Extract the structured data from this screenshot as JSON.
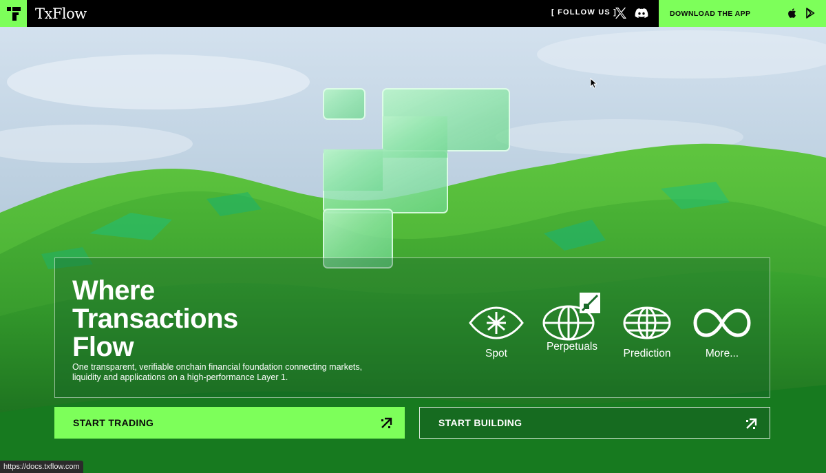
{
  "header": {
    "brand": "TxFlow",
    "follow_label": "[ FOLLOW US ]",
    "social": [
      "x-icon",
      "discord-icon"
    ],
    "download_label": "DOWNLOAD THE APP",
    "stores": [
      "apple-icon",
      "google-play-icon"
    ]
  },
  "hero": {
    "headline": [
      "Where",
      "Transactions",
      "Flow"
    ],
    "subtext": "One transparent, verifiable onchain financial foundation connecting markets, liquidity and applications on a high-performance Layer 1.",
    "features": [
      {
        "label": "Spot",
        "icon": "spot-eye-icon"
      },
      {
        "label": "Perpetuals",
        "icon": "perpetuals-globe-icon"
      },
      {
        "label": "Prediction",
        "icon": "prediction-globe-icon"
      },
      {
        "label": "More...",
        "icon": "infinity-icon"
      }
    ]
  },
  "actions": {
    "start_trading": "START TRADING",
    "start_building": "START BUILDING"
  },
  "status_bar": {
    "url": "https://docs.txflow.com"
  },
  "colors": {
    "accent": "#7dff5a",
    "topbar": "#000000"
  }
}
